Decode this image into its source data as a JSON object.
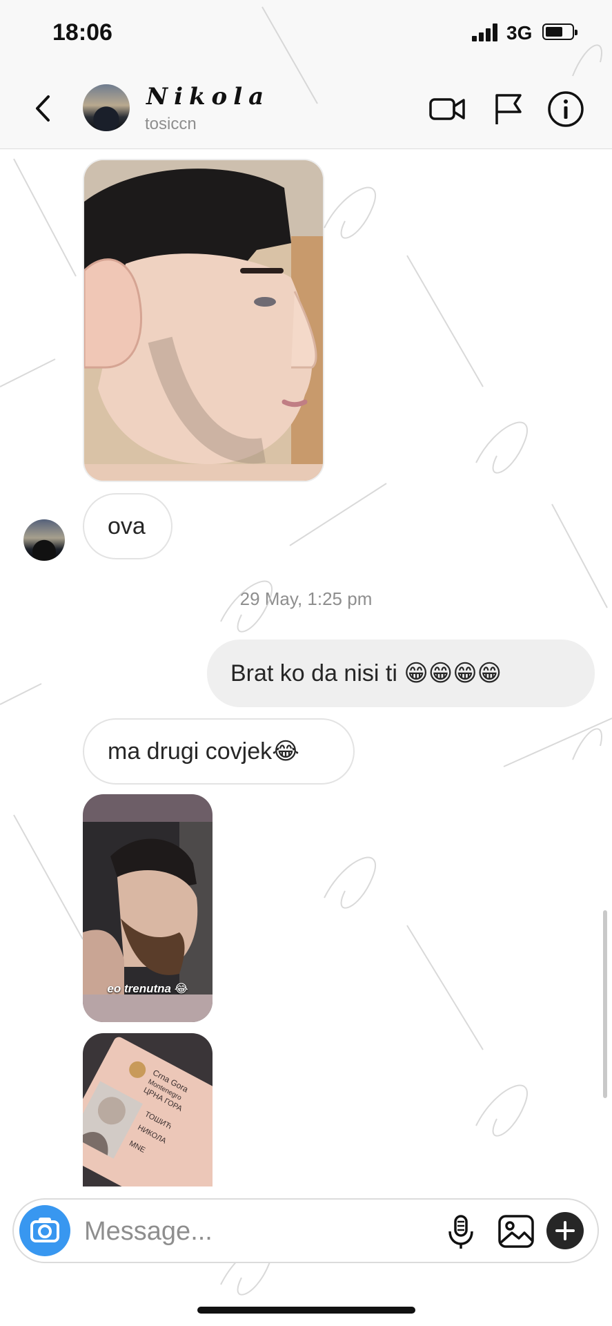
{
  "status_bar": {
    "time": "18:06",
    "network": "3G"
  },
  "header": {
    "contact_name": "Nikola",
    "username": "tosiccn",
    "icons": [
      "back-icon",
      "video-call-icon",
      "flag-icon",
      "info-icon"
    ]
  },
  "messages": {
    "incoming_1": "ova",
    "timestamp": "29 May, 1:25 pm",
    "outgoing_1": "Brat ko da nisi ti 😁😁😁😁",
    "incoming_2": "ma drugi covjek😂",
    "story_caption": "eo trenutna 😂",
    "id_card": {
      "line1": "Crna Gora",
      "line2": "Montenegro",
      "line3": "ЦРНА ГОРА",
      "surname": "ТОШИЋ",
      "given_name": "НИКОЛА",
      "code": "MNE"
    }
  },
  "composer": {
    "placeholder": "Message..."
  },
  "colors": {
    "accent": "#3897f0",
    "bubble_out": "#efefef",
    "text": "#262626",
    "muted": "#8e8e8e"
  }
}
